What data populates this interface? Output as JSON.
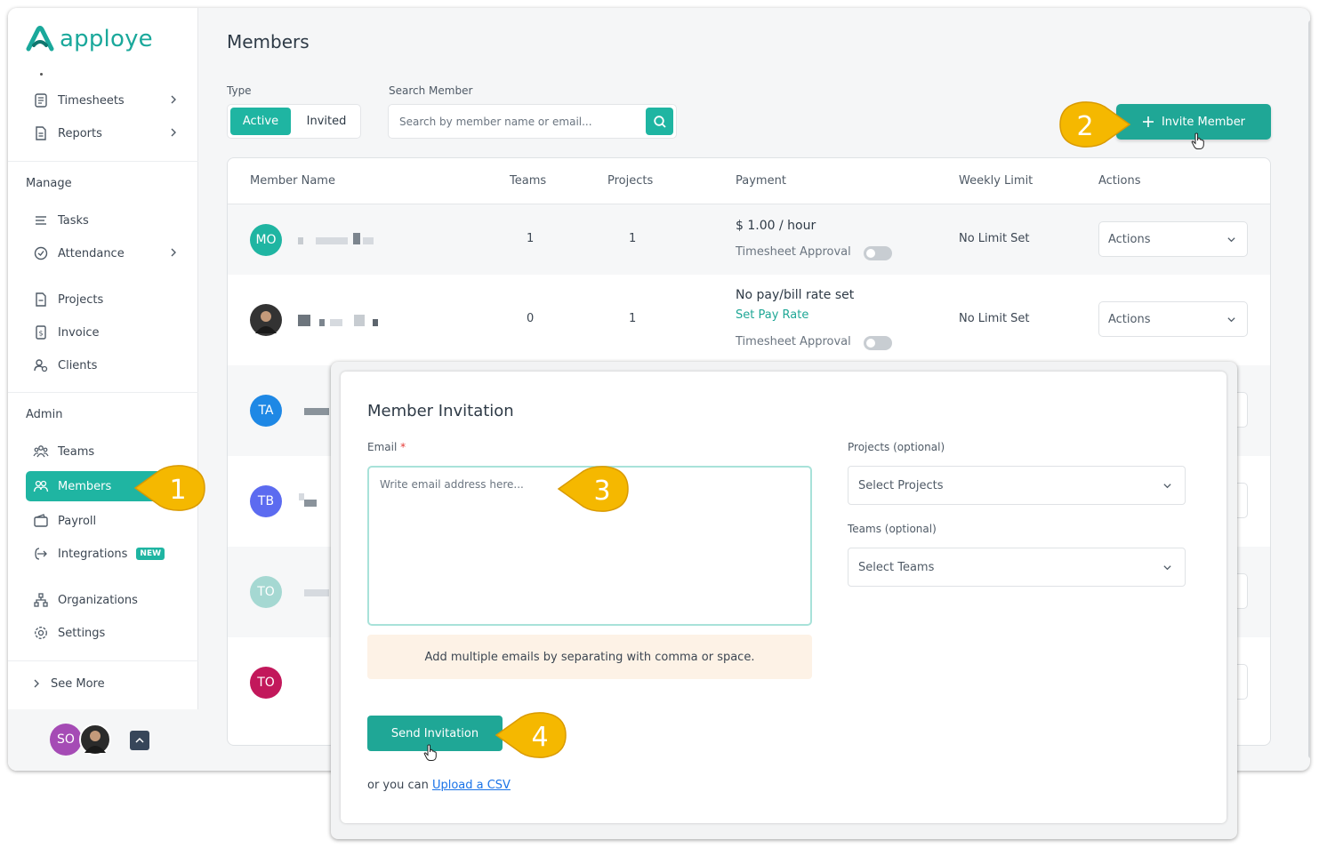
{
  "brand": {
    "name": "apploye",
    "color": "#1aa89b"
  },
  "sidebar": {
    "top_items": [
      {
        "label": "Timesheets",
        "icon": "timesheet-icon"
      },
      {
        "label": "Reports",
        "icon": "report-icon"
      }
    ],
    "manage_label": "Manage",
    "manage_items": [
      {
        "label": "Tasks",
        "icon": "tasks-icon"
      },
      {
        "label": "Attendance",
        "icon": "attendance-icon"
      },
      {
        "label": "Projects",
        "icon": "projects-icon"
      },
      {
        "label": "Invoice",
        "icon": "invoice-icon"
      },
      {
        "label": "Clients",
        "icon": "clients-icon"
      }
    ],
    "admin_label": "Admin",
    "admin_items": [
      {
        "label": "Teams",
        "icon": "teams-icon"
      },
      {
        "label": "Members",
        "icon": "members-icon",
        "active": true
      },
      {
        "label": "Payroll",
        "icon": "payroll-icon"
      },
      {
        "label": "Integrations",
        "icon": "integrations-icon",
        "badge": "NEW"
      },
      {
        "label": "Organizations",
        "icon": "organizations-icon"
      },
      {
        "label": "Settings",
        "icon": "settings-icon"
      }
    ],
    "see_more": "See More",
    "user_initials": "SO"
  },
  "main": {
    "title": "Members",
    "type_label": "Type",
    "type_options": [
      "Active",
      "Invited"
    ],
    "search_label": "Search Member",
    "search_placeholder": "Search by member name or email...",
    "invite_button": "Invite Member"
  },
  "table": {
    "headers": [
      "Member Name",
      "Teams",
      "Projects",
      "Payment",
      "Weekly Limit",
      "Actions"
    ],
    "rows": [
      {
        "initials": "MO",
        "color": "#1fb5a2",
        "teams": "1",
        "projects": "1",
        "payment": "$ 1.00 / hour",
        "approval": "Timesheet Approval",
        "limit": "No Limit Set",
        "actions": "Actions"
      },
      {
        "initials": "",
        "color": "#333333",
        "teams": "0",
        "projects": "1",
        "payment": "No pay/bill rate set",
        "set_pay": "Set Pay Rate",
        "approval": "Timesheet Approval",
        "limit": "No Limit Set",
        "actions": "Actions"
      },
      {
        "initials": "TA",
        "color": "#1e88e5"
      },
      {
        "initials": "TB",
        "color": "#5c6bf0"
      },
      {
        "initials": "TO",
        "color": "#a5d8d2"
      },
      {
        "initials": "TO",
        "color": "#c2185b"
      }
    ]
  },
  "modal": {
    "title": "Member Invitation",
    "email_label": "Email",
    "required_mark": "*",
    "email_placeholder": "Write email address here...",
    "hint": "Add multiple emails by separating with comma or space.",
    "projects_label": "Projects (optional)",
    "projects_placeholder": "Select Projects",
    "teams_label": "Teams (optional)",
    "teams_placeholder": "Select Teams",
    "send_button": "Send Invitation",
    "csv_prefix": "or you can ",
    "csv_link": "Upload a CSV"
  },
  "callouts": [
    "1",
    "2",
    "3",
    "4"
  ],
  "colors": {
    "accent": "#1fb5a2",
    "callout": "#f5b800"
  }
}
